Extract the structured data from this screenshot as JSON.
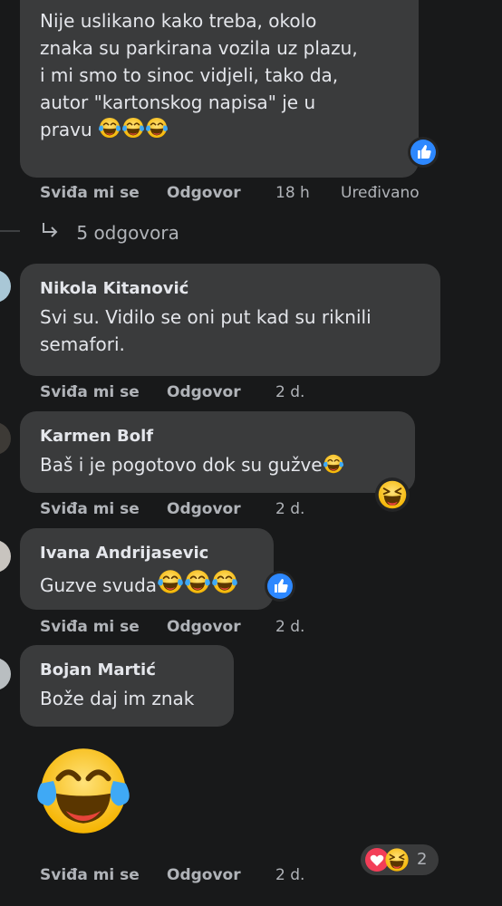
{
  "comments": [
    {
      "author": "",
      "text_lines": [
        "Nije uslikano kako treba, okolo",
        "znaka su parkirana vozila uz plazu,",
        "i mi smo to sinoc vidjeli, tako da,",
        "autor \"kartonskog napisa\" je u",
        "pravu"
      ],
      "like": "Sviđa mi se",
      "reply": "Odgovor",
      "time": "18 h",
      "edited": "Uređivano",
      "replies_link": "5 odgovora"
    },
    {
      "author": "Nikola Kitanović",
      "text_lines": [
        "Svi su. Vidilo se oni put kad su riknili",
        "semafori."
      ],
      "like": "Sviđa mi se",
      "reply": "Odgovor",
      "time": "2 d."
    },
    {
      "author": "Karmen Bolf",
      "text_lines": [
        "Baš i je pogotovo dok su gužve"
      ],
      "like": "Sviđa mi se",
      "reply": "Odgovor",
      "time": "2 d."
    },
    {
      "author": "Ivana Andrijasevic",
      "text_lines": [
        "Guzve svuda"
      ],
      "like": "Sviđa mi se",
      "reply": "Odgovor",
      "time": "2 d."
    },
    {
      "author": "Bojan Martić",
      "text_lines": [
        "Bože daj im znak"
      ],
      "like": "Sviđa mi se",
      "reply": "Odgovor",
      "time": "2 d.",
      "reaction_count": "2"
    }
  ],
  "icons": {
    "like_reaction": "thumbs-up-icon",
    "laugh_reaction": "laughing-crying-emoji-icon",
    "haha_reaction": "haha-emoji-icon",
    "love_reaction": "heart-icon",
    "reply_arrow": "reply-arrow-icon"
  },
  "colors": {
    "background": "#18191a",
    "bubble": "#3a3b3c",
    "text": "#e4e6eb",
    "secondary_text": "#b0b3b8",
    "like_blue": "#2d88ff",
    "love_red": "#f33e58"
  }
}
